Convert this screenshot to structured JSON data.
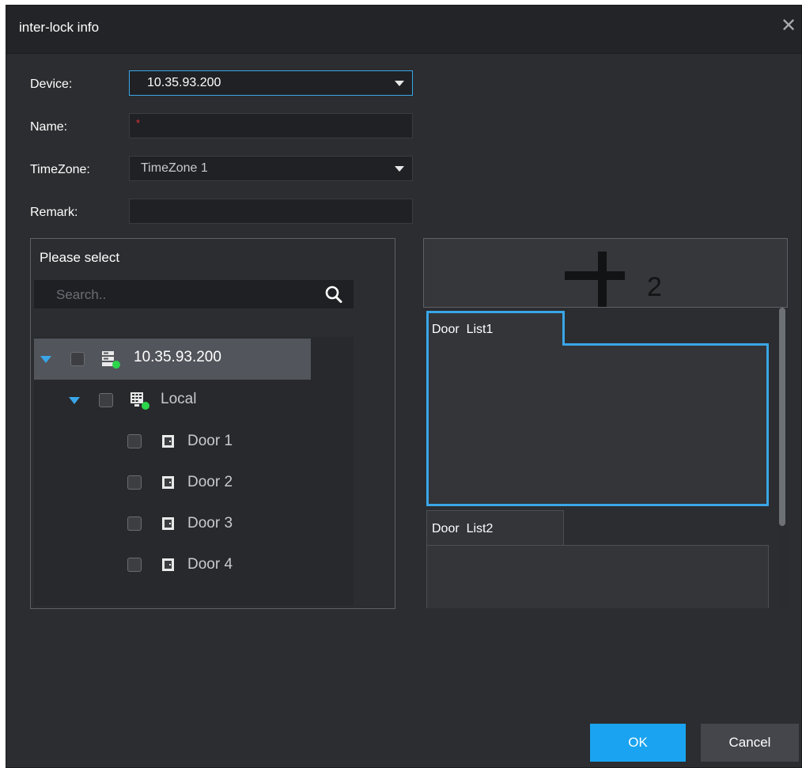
{
  "dialog": {
    "title": "inter-lock info",
    "close_icon": "close-icon"
  },
  "form": {
    "device": {
      "label": "Device:",
      "value": "10.35.93.200"
    },
    "name": {
      "label": "Name:",
      "value": "",
      "required_mark": "*"
    },
    "timezone": {
      "label": "TimeZone:",
      "value": "TimeZone 1"
    },
    "remark": {
      "label": "Remark:",
      "value": ""
    }
  },
  "tree_panel": {
    "title": "Please select",
    "search_placeholder": "Search..",
    "nodes": [
      {
        "label": "10.35.93.200",
        "icon": "server-icon",
        "expanded": true,
        "selected": true
      },
      {
        "label": "Local",
        "icon": "keypad-icon",
        "expanded": true
      },
      {
        "label": "Door 1",
        "icon": "door-icon"
      },
      {
        "label": "Door 2",
        "icon": "door-icon"
      },
      {
        "label": "Door 3",
        "icon": "door-icon"
      },
      {
        "label": "Door 4",
        "icon": "door-icon"
      }
    ]
  },
  "door_lists": {
    "add_icon": "plus-icon",
    "add_subscript": "2",
    "lists": [
      {
        "name": "Door  List1"
      },
      {
        "name": "Door  List2"
      }
    ]
  },
  "buttons": {
    "ok": "OK",
    "cancel": "Cancel"
  },
  "colors": {
    "accent": "#1aa3f0",
    "highlight_border": "#3aa6e8",
    "online_dot": "#2bd64b",
    "required": "#e0343a"
  }
}
